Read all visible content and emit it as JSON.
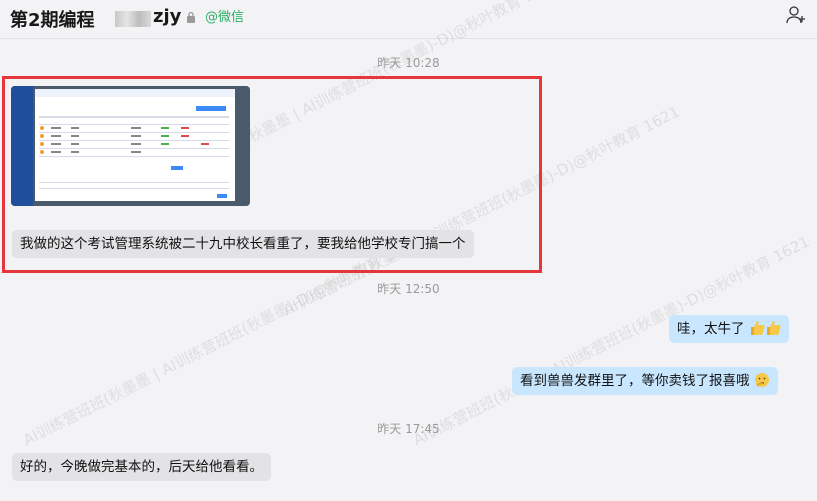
{
  "header": {
    "title_prefix": "第2期编程",
    "title_suffix": "zjy",
    "wechat_label": "@微信"
  },
  "messages": [
    {
      "type": "timestamp",
      "text": "昨天 10:28"
    },
    {
      "type": "image",
      "side": "left"
    },
    {
      "type": "text",
      "side": "left",
      "text": "我做的这个考试管理系统被二十九中校长看重了，要我给他学校专门搞一个"
    },
    {
      "type": "timestamp",
      "text": "昨天 12:50"
    },
    {
      "type": "text",
      "side": "right",
      "text": "哇，太牛了",
      "emoji": "thumbs-up-icon x2"
    },
    {
      "type": "text",
      "side": "right",
      "text": "看到兽兽发群里了，等你卖钱了报喜哦",
      "emoji": "thinking-face-icon"
    },
    {
      "type": "timestamp",
      "text": "昨天 17:45"
    },
    {
      "type": "text",
      "side": "left",
      "text": "好的，今晚做完基本的，后天给他看看。"
    }
  ],
  "watermark": "AI训练营班班(秋墨墨 | AI训练营班班(秋墨墨)-D)@秋叶教育 1621",
  "colors": {
    "background": "#f3f3f5",
    "left_bubble": "#e3e3e6",
    "right_bubble": "#c9e6ff",
    "highlight": "#e5373b",
    "wechat_green": "#2aae67"
  }
}
